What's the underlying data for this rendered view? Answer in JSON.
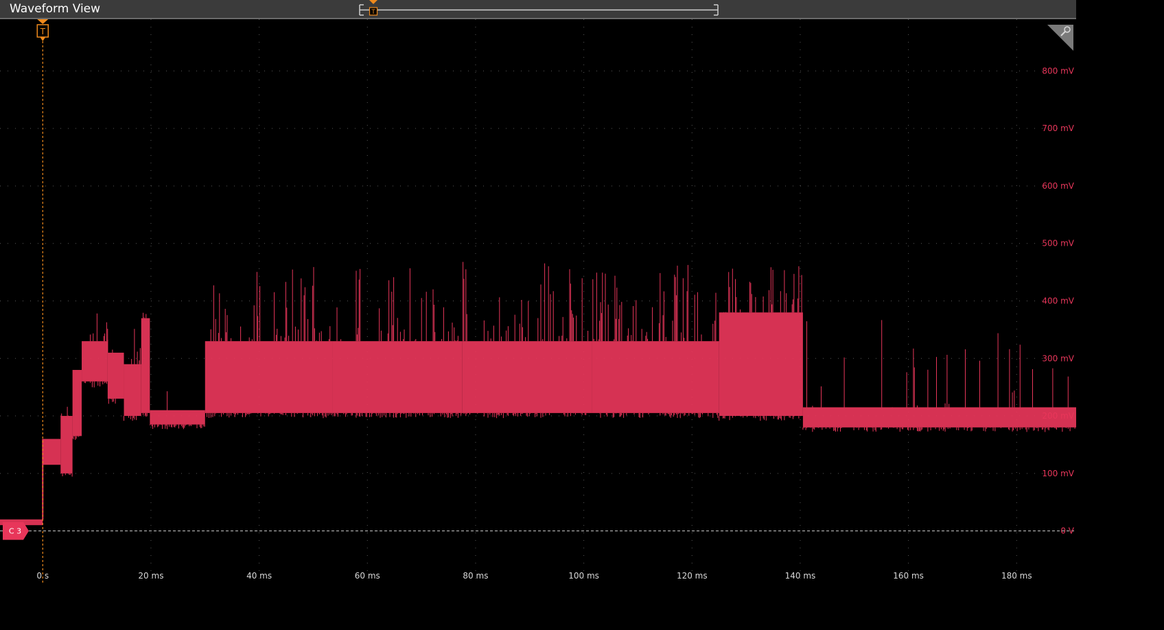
{
  "window": {
    "title": "Waveform View"
  },
  "colors": {
    "trace": "#e8365a",
    "trigger": "#f08a1c",
    "background": "#000000",
    "titlebar": "#3b3b3b",
    "grid": "#5a5a5a",
    "xlabel": "#d8d8d8"
  },
  "icons": {
    "trigger_marker": "trigger-t-icon",
    "zoom_trigger_marker": "trigger-t-icon",
    "zoom_corner": "magnifier-icon"
  },
  "trigger": {
    "label": "T"
  },
  "channel": {
    "label": "C 3"
  },
  "chart_data": {
    "type": "line",
    "title": "",
    "xlabel": "",
    "ylabel": "",
    "x_unit": "ms",
    "y_unit": "mV",
    "xlim": [
      -7.9,
      191.0
    ],
    "ylim": [
      -90,
      890
    ],
    "x_ticks": [
      0,
      20,
      40,
      60,
      80,
      100,
      120,
      140,
      160,
      180
    ],
    "x_tick_labels": [
      "0 s",
      "20 ms",
      "40 ms",
      "60 ms",
      "80 ms",
      "100 ms",
      "120 ms",
      "140 ms",
      "160 ms",
      "180 ms"
    ],
    "y_ticks": [
      0,
      100,
      200,
      300,
      400,
      500,
      600,
      700,
      800
    ],
    "y_tick_labels": [
      "0 V",
      "100 mV",
      "200 mV",
      "300 mV",
      "400 mV",
      "500 mV",
      "600 mV",
      "700 mV",
      "800 mV"
    ],
    "grid": true,
    "series": [
      {
        "name": "",
        "segments": [
          {
            "x0": -7.9,
            "x1": 0.0,
            "lo": 10,
            "hi": 20,
            "spike": 22,
            "density": 0
          },
          {
            "x0": 0.0,
            "x1": 3.3,
            "lo": 115,
            "hi": 160,
            "spike": 180,
            "density": 0
          },
          {
            "x0": 3.3,
            "x1": 5.5,
            "lo": 100,
            "hi": 200,
            "spike": 240,
            "density": 0.2
          },
          {
            "x0": 5.5,
            "x1": 7.2,
            "lo": 165,
            "hi": 280,
            "spike": 355,
            "density": 0.3
          },
          {
            "x0": 7.2,
            "x1": 12.0,
            "lo": 260,
            "hi": 330,
            "spike": 400,
            "density": 0.3
          },
          {
            "x0": 12.0,
            "x1": 15.0,
            "lo": 230,
            "hi": 310,
            "spike": 345,
            "density": 0.2
          },
          {
            "x0": 15.0,
            "x1": 18.2,
            "lo": 200,
            "hi": 290,
            "spike": 410,
            "density": 0.3
          },
          {
            "x0": 18.2,
            "x1": 19.8,
            "lo": 205,
            "hi": 370,
            "spike": 410,
            "density": 0.3
          },
          {
            "x0": 19.8,
            "x1": 30.0,
            "lo": 185,
            "hi": 210,
            "spike": 385,
            "density": 0.08
          },
          {
            "x0": 30.0,
            "x1": 53.5,
            "lo": 205,
            "hi": 330,
            "spike": 470,
            "density": 0.3
          },
          {
            "x0": 53.5,
            "x1": 77.5,
            "lo": 205,
            "hi": 330,
            "spike": 460,
            "density": 0.3
          },
          {
            "x0": 77.5,
            "x1": 101.5,
            "lo": 205,
            "hi": 330,
            "spike": 475,
            "density": 0.3
          },
          {
            "x0": 101.5,
            "x1": 125.0,
            "lo": 205,
            "hi": 330,
            "spike": 465,
            "density": 0.3
          },
          {
            "x0": 125.0,
            "x1": 140.5,
            "lo": 200,
            "hi": 380,
            "spike": 465,
            "density": 0.3
          },
          {
            "x0": 140.5,
            "x1": 191.0,
            "lo": 180,
            "hi": 215,
            "spike": 380,
            "density": 0.1
          }
        ]
      }
    ]
  }
}
